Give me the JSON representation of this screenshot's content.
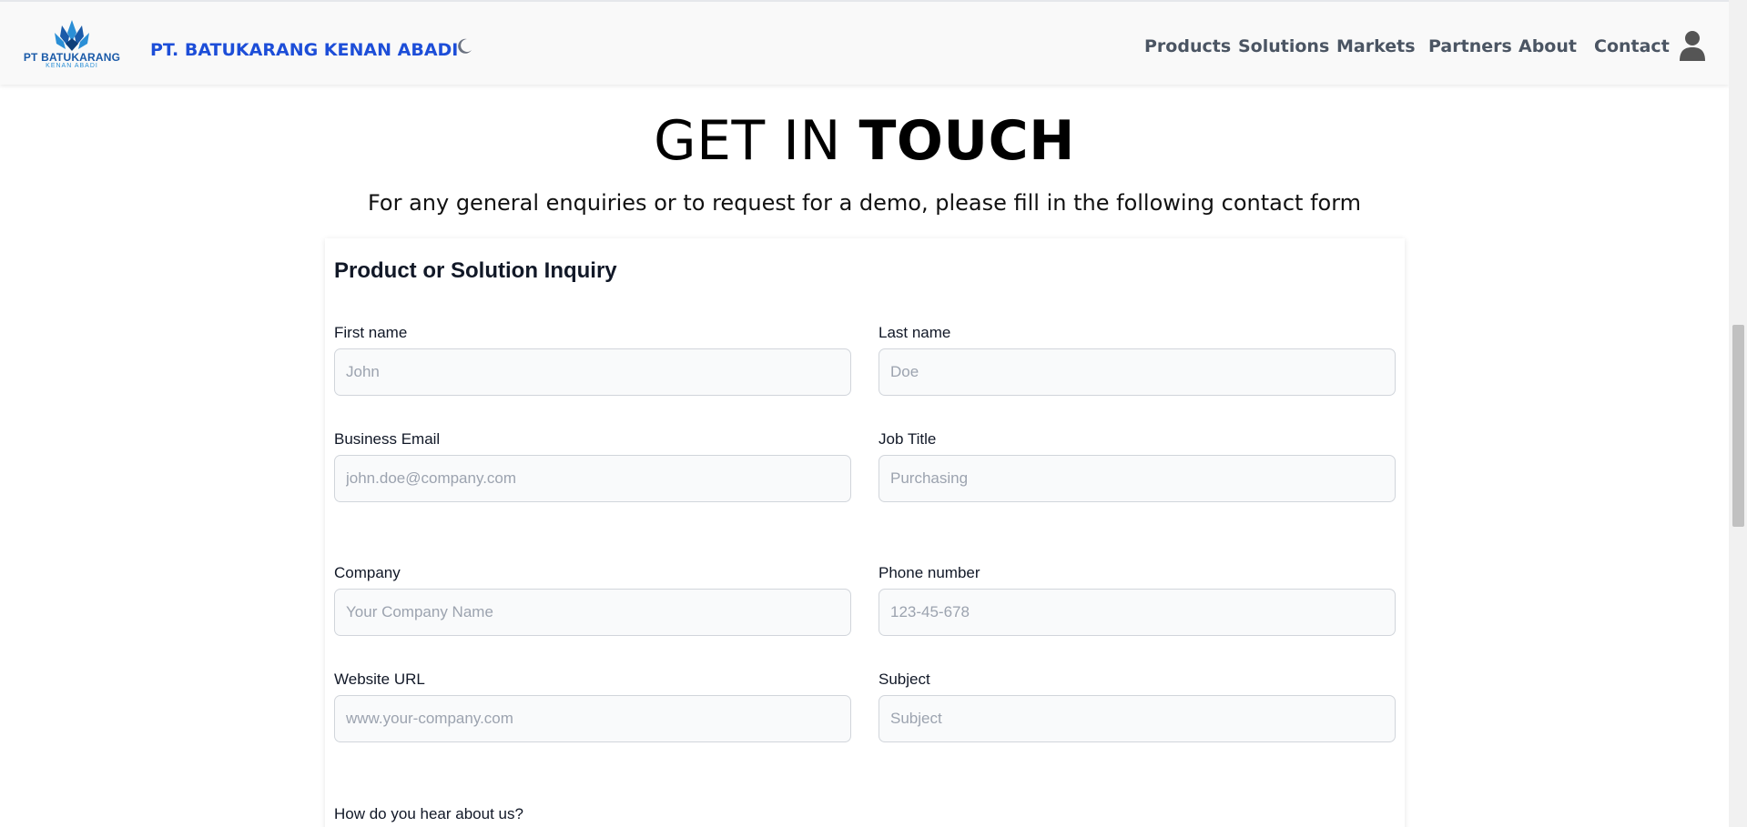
{
  "header": {
    "logo_line1": "PT BATUKARANG",
    "logo_line2": "KENAN ABADI",
    "brand": "PT. BATUKARANG KENAN ABADI",
    "nav": [
      "Products",
      "Solutions",
      "Markets",
      "Partners",
      "About",
      "Contact"
    ]
  },
  "hero": {
    "title_light": "GET IN ",
    "title_bold": "TOUCH",
    "subtitle": "For any general enquiries or to request for a demo, please fill in the following contact form"
  },
  "form": {
    "title": "Product or Solution Inquiry",
    "fields": {
      "first_name": {
        "label": "First name",
        "placeholder": "John",
        "value": ""
      },
      "last_name": {
        "label": "Last name",
        "placeholder": "Doe",
        "value": ""
      },
      "email": {
        "label": "Business Email",
        "placeholder": "john.doe@company.com",
        "value": ""
      },
      "job_title": {
        "label": "Job Title",
        "placeholder": "Purchasing",
        "value": ""
      },
      "company": {
        "label": "Company",
        "placeholder": "Your Company Name",
        "value": ""
      },
      "phone": {
        "label": "Phone number",
        "placeholder": "123-45-678",
        "value": ""
      },
      "website": {
        "label": "Website URL",
        "placeholder": "www.your-company.com",
        "value": ""
      },
      "subject": {
        "label": "Subject",
        "placeholder": "Subject",
        "value": ""
      }
    },
    "hear_about_label": "How do you hear about us?"
  },
  "colors": {
    "brand_blue": "#1d4ed8",
    "nav_text": "#4b5563",
    "logo_blue": "#1a5aa8",
    "logo_light_blue": "#2b8fd6"
  },
  "icons": {
    "theme_toggle": "moon-icon",
    "user": "user-icon"
  }
}
